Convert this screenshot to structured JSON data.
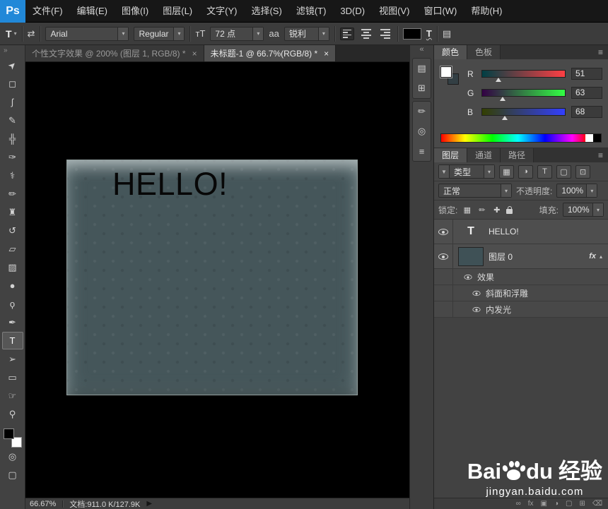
{
  "menu_bar": {
    "logo": "Ps",
    "items": [
      "文件(F)",
      "编辑(E)",
      "图像(I)",
      "图层(L)",
      "文字(Y)",
      "选择(S)",
      "滤镜(T)",
      "3D(D)",
      "视图(V)",
      "窗口(W)",
      "帮助(H)"
    ]
  },
  "options_bar": {
    "tool_glyph": "T",
    "font_family": "Arial",
    "font_style": "Regular",
    "font_size": "72 点",
    "anti_alias": "锐利",
    "text_color": "#000000"
  },
  "icons": {
    "dropdown_arrow": "▾",
    "tool_preset_arrow": "▾",
    "orientation_icon": "⇄",
    "font_size_icon": "тT",
    "anti_alias_icon": "aa",
    "warp_text_icon": "T",
    "panels_icon": "▤",
    "toolbar_collapse": "»",
    "dock_collapse": "«",
    "panel_menu": "≡",
    "filter_funnel": "▼",
    "status_arrow": "▶",
    "close": "×",
    "fx_collapse": "▴"
  },
  "toolbar": {
    "foreground": "#000000",
    "background": "#ffffff",
    "quick_mask_glyph": "◎",
    "screen_mode_glyph": "▢",
    "tools": [
      {
        "name": "move",
        "glyph": "➤"
      },
      {
        "name": "rectangular-marquee",
        "glyph": "◻"
      },
      {
        "name": "lasso",
        "glyph": "ʃ"
      },
      {
        "name": "quick-selection",
        "glyph": "✎"
      },
      {
        "name": "crop",
        "glyph": "╬"
      },
      {
        "name": "eyedropper",
        "glyph": "✑"
      },
      {
        "name": "healing-brush",
        "glyph": "⚕"
      },
      {
        "name": "brush",
        "glyph": "✏"
      },
      {
        "name": "clone-stamp",
        "glyph": "♜"
      },
      {
        "name": "history-brush",
        "glyph": "↺"
      },
      {
        "name": "eraser",
        "glyph": "▱"
      },
      {
        "name": "gradient",
        "glyph": "▨"
      },
      {
        "name": "blur",
        "glyph": "●"
      },
      {
        "name": "dodge",
        "glyph": "ϙ"
      },
      {
        "name": "pen",
        "glyph": "✒"
      },
      {
        "name": "type",
        "glyph": "T",
        "selected": true
      },
      {
        "name": "path-selection",
        "glyph": "➢"
      },
      {
        "name": "rectangle",
        "glyph": "▭"
      },
      {
        "name": "hand",
        "glyph": "☞"
      },
      {
        "name": "zoom",
        "glyph": "⚲"
      }
    ]
  },
  "dock_strip": {
    "icons": [
      "▤",
      "⊞",
      "✏",
      "◎",
      "≡"
    ]
  },
  "tabs": [
    {
      "label": "个性文字效果 @ 200% (图层 1, RGB/8) *"
    },
    {
      "label": "未标题-1 @ 66.7%(RGB/8) *"
    }
  ],
  "canvas": {
    "text": "HELLO!",
    "fill": "#45565a"
  },
  "color_panel": {
    "tabs": [
      "颜色",
      "色板"
    ],
    "front_swatch": "#ffffff",
    "back_swatch": "#333f44",
    "channels": [
      {
        "label": "R",
        "value": "51",
        "percent": 20
      },
      {
        "label": "G",
        "value": "63",
        "percent": 25
      },
      {
        "label": "B",
        "value": "68",
        "percent": 27
      }
    ]
  },
  "layers_panel": {
    "tabs": [
      "图层",
      "通道",
      "路径"
    ],
    "filter_label": "类型",
    "filter_type_icons": [
      "▦",
      "◑",
      "T",
      "▢",
      "⊡"
    ],
    "blend_mode": "正常",
    "opacity_label": "不透明度:",
    "opacity_value": "100%",
    "lock_label": "锁定:",
    "lock_icons": [
      "▦",
      "✏",
      "✚"
    ],
    "fill_label": "填充:",
    "fill_value": "100%",
    "layers": [
      {
        "name": "HELLO!",
        "kind": "text",
        "thumb_glyph": "T"
      },
      {
        "name": "图层 0",
        "kind": "pixel",
        "thumb_color": "#3f5156",
        "fx_badge": "fx",
        "effects": [
          "效果",
          "斜面和浮雕",
          "内发光"
        ]
      }
    ],
    "bottom_icons": [
      "∞",
      "fx",
      "▣",
      "◑",
      "▢",
      "⊞",
      "⌫"
    ]
  },
  "watermark": {
    "brand_prefix": "Bai",
    "brand_suffix": "du",
    "brand_cn": "经验",
    "url": "jingyan.baidu.com"
  },
  "status_bar": {
    "zoom": "66.67%",
    "doc_info": "文档:911.0 K/127.9K"
  }
}
